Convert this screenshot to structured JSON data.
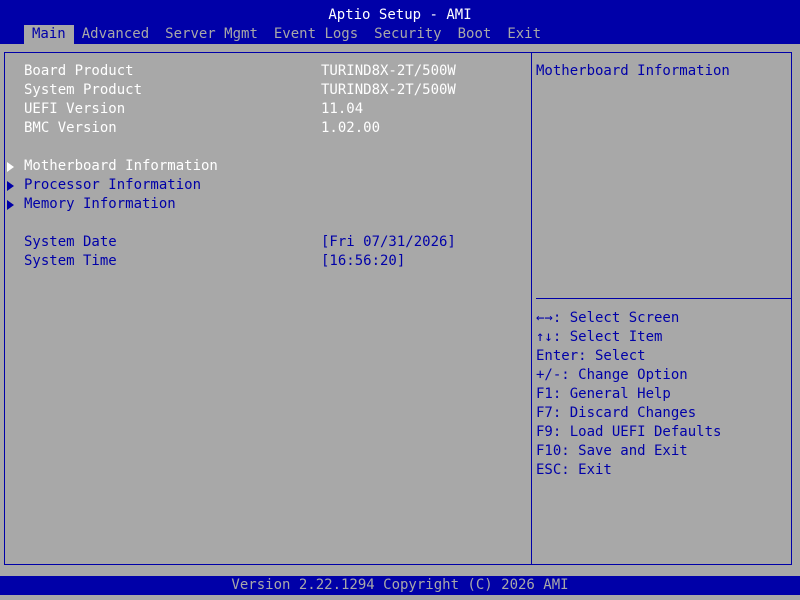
{
  "header": {
    "title": "Aptio Setup - AMI",
    "tabs": [
      {
        "label": "Main"
      },
      {
        "label": "Advanced"
      },
      {
        "label": "Server Mgmt"
      },
      {
        "label": "Event Logs"
      },
      {
        "label": "Security"
      },
      {
        "label": "Boot"
      },
      {
        "label": "Exit"
      }
    ],
    "active_tab": "Main"
  },
  "info": [
    {
      "label": "Board Product",
      "value": "TURIND8X-2T/500W"
    },
    {
      "label": "System Product",
      "value": "TURIND8X-2T/500W"
    },
    {
      "label": "UEFI Version",
      "value": "11.04"
    },
    {
      "label": "BMC Version",
      "value": "1.02.00"
    }
  ],
  "submenus": [
    {
      "label": "Motherboard Information"
    },
    {
      "label": "Processor Information"
    },
    {
      "label": "Memory Information"
    }
  ],
  "settings": [
    {
      "label": "System Date",
      "value": "[Fri 07/31/2026]"
    },
    {
      "label": "System Time",
      "value": "[16:56:20]"
    }
  ],
  "help": {
    "title": "Motherboard Information",
    "keys": [
      "←→: Select Screen",
      "↑↓: Select Item",
      "Enter: Select",
      "+/-: Change Option",
      "F1: General Help",
      "F7: Discard Changes",
      "F9: Load UEFI Defaults",
      "F10: Save and Exit",
      "ESC: Exit"
    ]
  },
  "footer": {
    "text": "Version 2.22.1294 Copyright (C) 2026 AMI"
  },
  "colors": {
    "background": "#a8a8a8",
    "accent": "#0000a8",
    "highlight": "#ffffff"
  }
}
